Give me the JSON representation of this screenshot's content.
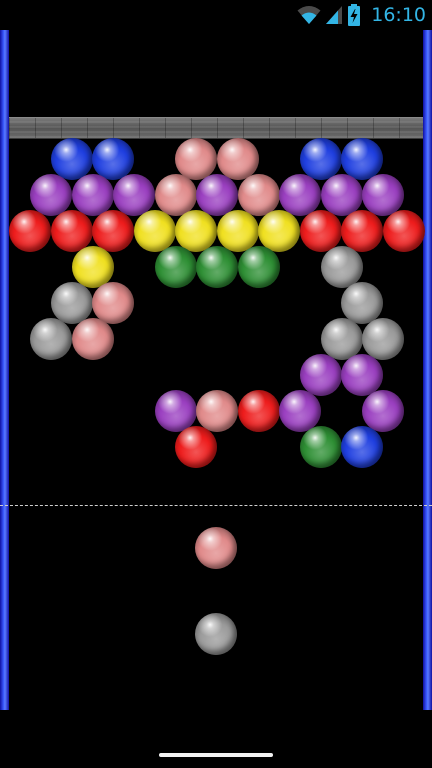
{
  "status_bar": {
    "time": "16:10",
    "icons": [
      "wifi-icon",
      "cellular-signal-icon",
      "battery-charging-icon"
    ]
  },
  "colors": {
    "blue": "#1f3fe0",
    "pink": "#e08a8a",
    "purple": "#9a3fc0",
    "red": "#ee1c1c",
    "yellow": "#f0e020",
    "green": "#2e8f34",
    "gray": "#9a9a9a",
    "wall": "#3b5bff",
    "ceiling": "#666666"
  },
  "grid": {
    "rows": [
      [
        "",
        "blue",
        "blue",
        "",
        "pink",
        "pink",
        "",
        "blue",
        "blue",
        ""
      ],
      [
        "purple",
        "purple",
        "purple",
        "pink",
        "purple",
        "pink",
        "purple",
        "purple",
        "purple"
      ],
      [
        "red",
        "red",
        "red",
        "yellow",
        "yellow",
        "yellow",
        "yellow",
        "red",
        "red",
        "red"
      ],
      [
        "",
        "yellow",
        "",
        "green",
        "green",
        "green",
        "",
        "gray",
        ""
      ],
      [
        "",
        "gray",
        "pink",
        "",
        "",
        "",
        "",
        "",
        "gray",
        ""
      ],
      [
        "gray",
        "pink",
        "",
        "",
        "",
        "",
        "",
        "gray",
        "gray"
      ],
      [
        "",
        "",
        "",
        "",
        "",
        "",
        "",
        "purple",
        "purple",
        ""
      ],
      [
        "",
        "",
        "",
        "purple",
        "pink",
        "red",
        "purple",
        "",
        "purple"
      ],
      [
        "",
        "",
        "",
        "",
        "red",
        "",
        "",
        "green",
        "blue",
        ""
      ]
    ]
  },
  "launcher": {
    "current": "pink",
    "next": "gray"
  }
}
